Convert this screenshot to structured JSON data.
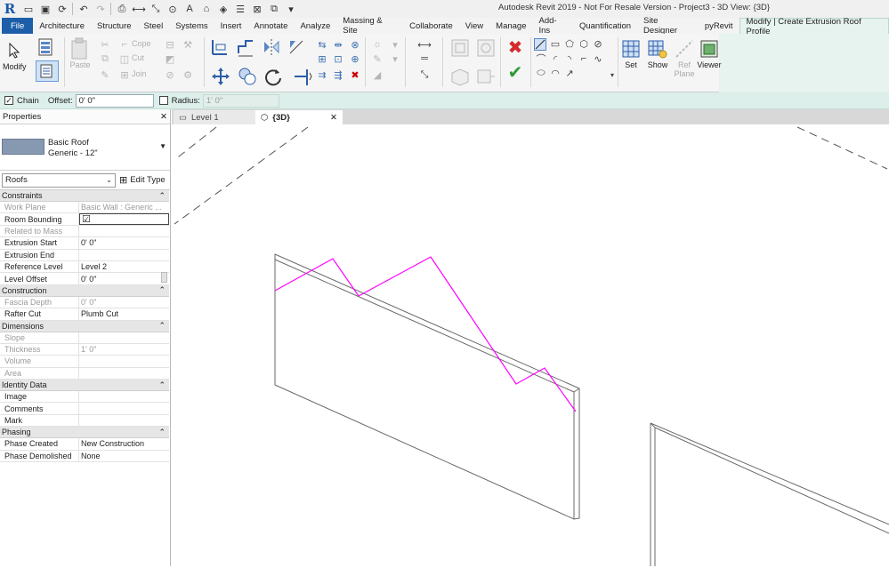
{
  "app": {
    "title": "Autodesk Revit 2019 - Not For Resale Version - Project3 - 3D View: {3D}"
  },
  "qat": {
    "logo": "R"
  },
  "tabs": [
    {
      "label": "File"
    },
    {
      "label": "Architecture"
    },
    {
      "label": "Structure"
    },
    {
      "label": "Steel"
    },
    {
      "label": "Systems"
    },
    {
      "label": "Insert"
    },
    {
      "label": "Annotate"
    },
    {
      "label": "Analyze"
    },
    {
      "label": "Massing & Site"
    },
    {
      "label": "Collaborate"
    },
    {
      "label": "View"
    },
    {
      "label": "Manage"
    },
    {
      "label": "Add-Ins"
    },
    {
      "label": "Quantification"
    },
    {
      "label": "Site Designer"
    },
    {
      "label": "pyRevit"
    },
    {
      "label": "Modify | Create Extrusion Roof Profile"
    }
  ],
  "ribbon": {
    "modify": "Modify",
    "paste": "Paste",
    "cope": "Cope",
    "cut": "Cut",
    "join": "Join",
    "set": "Set",
    "show": "Show",
    "ref_plane": "Ref\nPlane",
    "viewer": "Viewer"
  },
  "options": {
    "chain_label": "Chain",
    "chain_checked": true,
    "offset_label": "Offset:",
    "offset_value": "0'  0\"",
    "radius_label": "Radius:",
    "radius_value": "1'  0\""
  },
  "properties": {
    "header": "Properties",
    "close": "✕",
    "type_name": "Basic Roof",
    "type_sub": "Generic - 12\"",
    "category": "Roofs",
    "edit_type": "Edit Type",
    "sections": [
      {
        "name": "Constraints",
        "rows": [
          {
            "key": "Work Plane",
            "value": "Basic Wall : Generic ...",
            "dim": true
          },
          {
            "key": "Room Bounding",
            "value": "☑",
            "dim": false
          },
          {
            "key": "Related to Mass",
            "value": "",
            "dim": true
          },
          {
            "key": "Extrusion Start",
            "value": "0'  0\"",
            "dim": false
          },
          {
            "key": "Extrusion End",
            "value": "",
            "dim": false
          },
          {
            "key": "Reference Level",
            "value": "Level 2",
            "dim": false
          },
          {
            "key": "Level Offset",
            "value": "0'  0\"",
            "dim": false
          }
        ]
      },
      {
        "name": "Construction",
        "rows": [
          {
            "key": "Fascia Depth",
            "value": "0'  0\"",
            "dim": true
          },
          {
            "key": "Rafter Cut",
            "value": "Plumb Cut",
            "dim": false
          }
        ]
      },
      {
        "name": "Dimensions",
        "rows": [
          {
            "key": "Slope",
            "value": "",
            "dim": true
          },
          {
            "key": "Thickness",
            "value": "1'  0\"",
            "dim": true
          },
          {
            "key": "Volume",
            "value": "",
            "dim": true
          },
          {
            "key": "Area",
            "value": "",
            "dim": true
          }
        ]
      },
      {
        "name": "Identity Data",
        "rows": [
          {
            "key": "Image",
            "value": "",
            "dim": false
          },
          {
            "key": "Comments",
            "value": "",
            "dim": false
          },
          {
            "key": "Mark",
            "value": "",
            "dim": false
          }
        ]
      },
      {
        "name": "Phasing",
        "rows": [
          {
            "key": "Phase Created",
            "value": "New Construction",
            "dim": false
          },
          {
            "key": "Phase Demolished",
            "value": "None",
            "dim": false
          }
        ]
      }
    ]
  },
  "view_tabs": [
    {
      "label": "Level 1"
    },
    {
      "label": "{3D}"
    }
  ],
  "colors": {
    "sketch": "#ff00ff",
    "file_tab": "#1d5ea8",
    "context_tab": "#e6f3ee"
  }
}
